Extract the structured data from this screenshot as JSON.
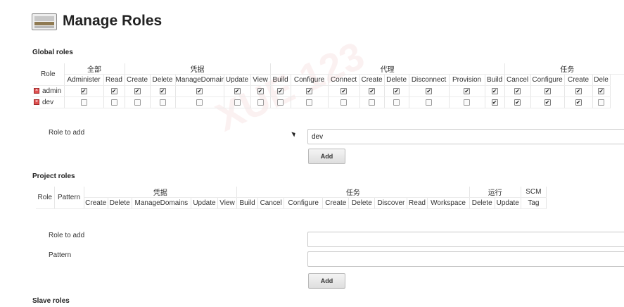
{
  "page": {
    "title": "Manage Roles"
  },
  "global_roles": {
    "title": "Global roles",
    "role_header": "Role",
    "groups": [
      {
        "label": "全部",
        "span": 2
      },
      {
        "label": "凭据",
        "span": 5
      },
      {
        "label": "代理",
        "span": 8
      },
      {
        "label": "任务",
        "span": 5
      }
    ],
    "columns": [
      "Administer",
      "Read",
      "Create",
      "Delete",
      "ManageDomains",
      "Update",
      "View",
      "Build",
      "Configure",
      "Connect",
      "Create",
      "Delete",
      "Disconnect",
      "Provision",
      "Build",
      "Cancel",
      "Configure",
      "Create",
      "Dele"
    ],
    "rows": [
      {
        "name": "admin",
        "checks": [
          1,
          1,
          1,
          1,
          1,
          1,
          1,
          1,
          1,
          1,
          1,
          1,
          1,
          1,
          1,
          1,
          1,
          1,
          1
        ]
      },
      {
        "name": "dev",
        "checks": [
          0,
          0,
          0,
          0,
          0,
          0,
          0,
          0,
          0,
          0,
          0,
          0,
          0,
          0,
          1,
          1,
          1,
          1,
          0
        ]
      }
    ],
    "role_to_add_label": "Role to add",
    "role_to_add_value": "dev",
    "add_label": "Add"
  },
  "project_roles": {
    "title": "Project roles",
    "role_header": "Role",
    "pattern_header": "Pattern",
    "groups": [
      {
        "label": "凭据",
        "span": 5
      },
      {
        "label": "任务",
        "span": 8
      },
      {
        "label": "运行",
        "span": 2
      },
      {
        "label": "SCM",
        "span": 1
      }
    ],
    "columns": [
      "Create",
      "Delete",
      "ManageDomains",
      "Update",
      "View",
      "Build",
      "Cancel",
      "Configure",
      "Create",
      "Delete",
      "Discover",
      "Read",
      "Workspace",
      "Delete",
      "Update",
      "Tag"
    ],
    "role_to_add_label": "Role to add",
    "role_to_add_value": "",
    "pattern_label": "Pattern",
    "pattern_value": "",
    "add_label": "Add"
  },
  "slave_roles": {
    "title": "Slave roles"
  },
  "icons": {
    "header": "roles-manager-icon",
    "delete": "delete-icon"
  }
}
